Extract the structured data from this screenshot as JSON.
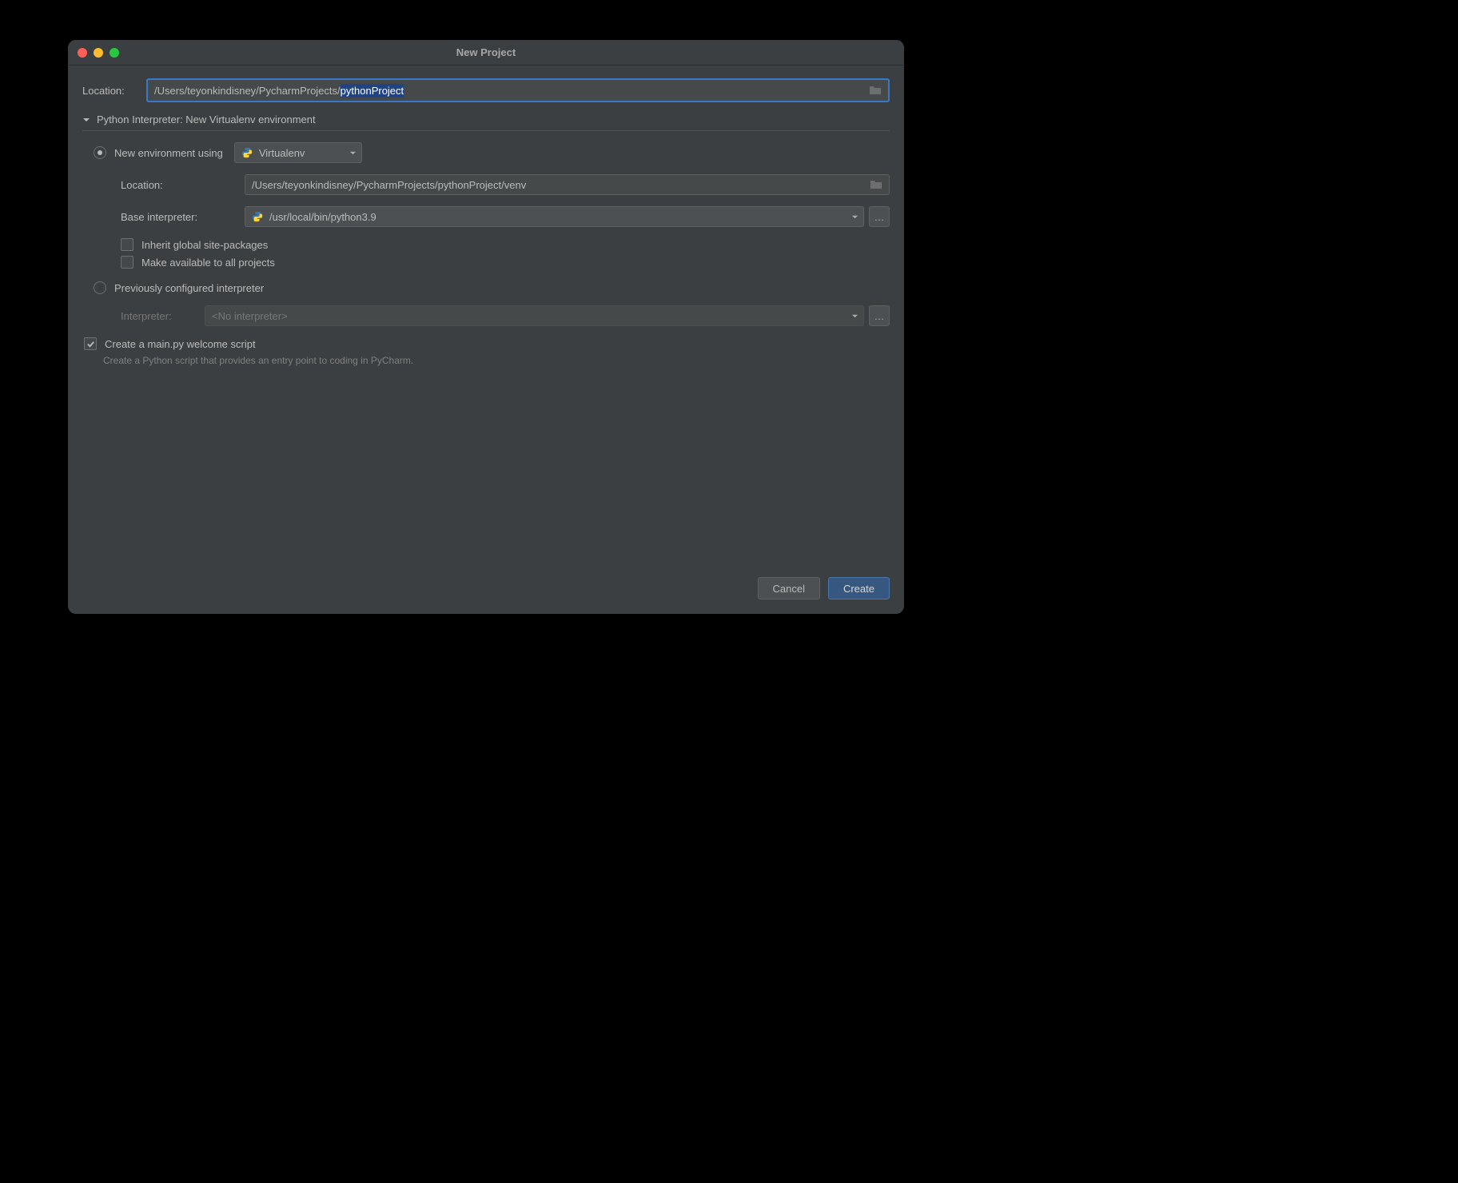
{
  "window": {
    "title": "New Project"
  },
  "location": {
    "label": "Location:",
    "path_prefix": "/Users/teyonkindisney/PycharmProjects/",
    "path_selected": "pythonProject"
  },
  "interpreter_section": {
    "title": "Python Interpreter: New Virtualenv environment"
  },
  "new_env": {
    "radio_label": "New environment using",
    "env_type": "Virtualenv",
    "location_label": "Location:",
    "location_value": "/Users/teyonkindisney/PycharmProjects/pythonProject/venv",
    "base_interpreter_label": "Base interpreter:",
    "base_interpreter_value": "/usr/local/bin/python3.9",
    "inherit_label": "Inherit global site-packages",
    "make_available_label": "Make available to all projects"
  },
  "prev_configured": {
    "radio_label": "Previously configured interpreter",
    "interpreter_label": "Interpreter:",
    "interpreter_value": "<No interpreter>"
  },
  "main_py": {
    "label": "Create a main.py welcome script",
    "helper": "Create a Python script that provides an entry point to coding in PyCharm."
  },
  "buttons": {
    "cancel": "Cancel",
    "create": "Create"
  }
}
